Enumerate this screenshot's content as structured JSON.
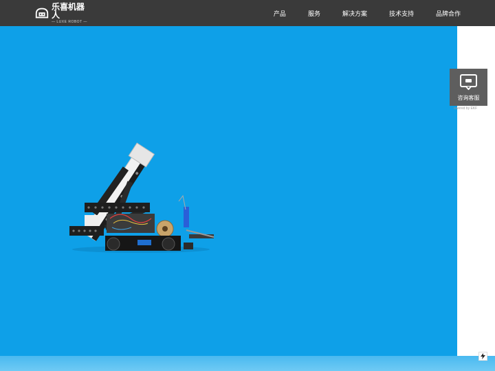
{
  "logo": {
    "name": "乐喜机器人",
    "tagline": "— LUXE ROBOT —",
    "icon": "robot-logo-icon"
  },
  "nav": {
    "items": [
      {
        "label": "产品"
      },
      {
        "label": "服务"
      },
      {
        "label": "解决方案"
      },
      {
        "label": "技术支持"
      },
      {
        "label": "品牌合作"
      }
    ]
  },
  "hero": {
    "background_color": "#0ea0e8",
    "image": "robot-kit-illustration"
  },
  "chat_widget": {
    "label": "咨询客服",
    "powered_by": "owered by EKF",
    "icon": "chat-bubble-icon"
  },
  "colors": {
    "navbar": "#3a3a3a",
    "accent_blue": "#0ea0e8",
    "widget": "#5e5e5e"
  }
}
